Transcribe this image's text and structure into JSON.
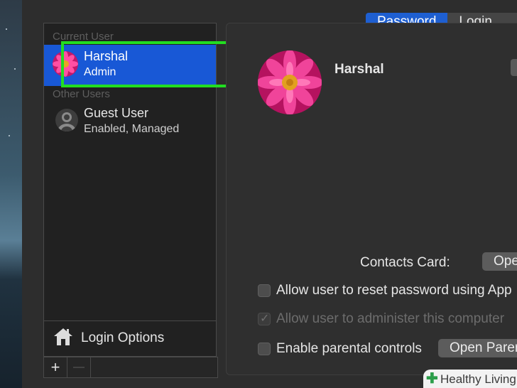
{
  "tabs": [
    {
      "label": "Password",
      "active": true
    },
    {
      "label": "Login Iter",
      "active": false
    }
  ],
  "sidebar": {
    "current_user_header": "Current User",
    "other_users_header": "Other Users",
    "users": [
      {
        "name": "Harshal",
        "role": "Admin",
        "selected": true,
        "icon": "pink-flower-avatar"
      },
      {
        "name": "Guest User",
        "role": "Enabled, Managed",
        "selected": false,
        "icon": "guest-user-icon"
      }
    ],
    "login_options_label": "Login Options",
    "footer": {
      "add": "+",
      "remove": "—"
    }
  },
  "main": {
    "user_name": "Harshal",
    "contacts_label": "Contacts Card:",
    "contacts_button": "Open...",
    "checkboxes": [
      {
        "label": "Allow user to reset password using App",
        "checked": false,
        "disabled": false
      },
      {
        "label": "Allow user to administer this computer",
        "checked": true,
        "disabled": true
      },
      {
        "label": "Enable parental controls",
        "checked": false,
        "disabled": false
      }
    ],
    "parental_button": "Open Parer"
  },
  "watermark": {
    "brand": "Healthy Living"
  },
  "colors": {
    "selection": "#1858d6",
    "highlight": "#22dd22",
    "tab_active": "#1e5fd1"
  }
}
